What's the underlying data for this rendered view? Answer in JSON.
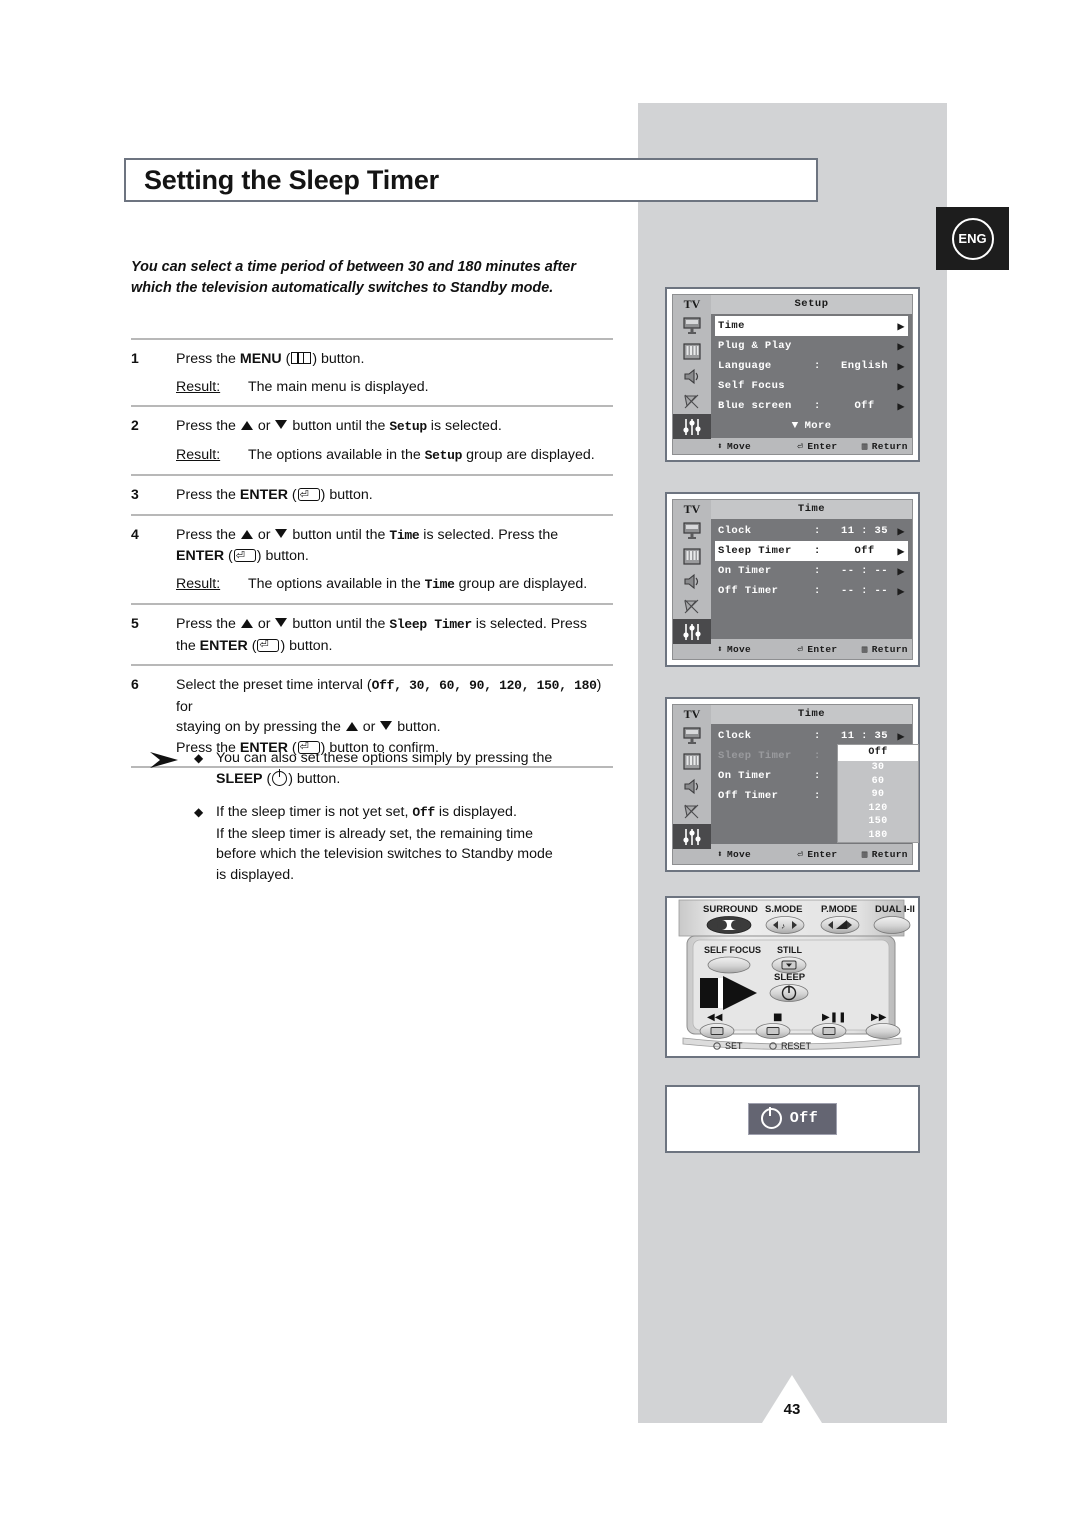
{
  "page": {
    "title": "Setting the Sleep Timer",
    "language_badge": "ENG",
    "page_number": "43",
    "intro_line1": "You can select a time period of between 30 and 180 minutes after",
    "intro_line2": "which the television automatically switches to Standby mode."
  },
  "steps": [
    {
      "num": "1",
      "text_a": "Press the ",
      "kb": "MENU",
      "icon": "menu-icon",
      "text_b": " button.",
      "result_label": "Result:",
      "result_text": "The main menu is displayed."
    },
    {
      "num": "2",
      "text_a": "Press the ",
      "text_b": " button until the ",
      "mono": "Setup",
      "text_c": " is selected.",
      "result_label": "Result:",
      "result_pre": "The options available in the ",
      "result_mono": "Setup",
      "result_post": " group are displayed."
    },
    {
      "num": "3",
      "text_a": "Press the ",
      "kb": "ENTER",
      "icon": "enter-icon",
      "text_b": " button."
    },
    {
      "num": "4",
      "text_a": "Press the ",
      "text_b": " button until the ",
      "mono": "Time",
      "text_c": " is selected. Press the",
      "kb2": "ENTER",
      "text_d": " button.",
      "result_label": "Result:",
      "result_pre": "The options available in the ",
      "result_mono": "Time",
      "result_post": " group are displayed."
    },
    {
      "num": "5",
      "text_a": "Press the ",
      "text_b": " button until the ",
      "mono": "Sleep Timer",
      "text_c": " is selected. Press",
      "text_d": "the ",
      "kb2": "ENTER",
      "text_e": " button."
    },
    {
      "num": "6",
      "text_a": "Select the preset time interval (",
      "options": "Off, 30, 60, 90, 120, 150, 180",
      "text_b": ") for",
      "text_c": "staying on by pressing the ",
      "text_d": " button.",
      "text_e": "Press the ",
      "kb": "ENTER",
      "text_f": " button to confirm."
    }
  ],
  "notes": [
    {
      "line1_a": "You can also set these options simply by pressing the",
      "line2_kb": "SLEEP",
      "line2_b": " button."
    },
    {
      "line1_a": "If the sleep timer is not yet set, ",
      "line1_mono": "Off",
      "line1_b": " is displayed.",
      "line2": "If the sleep timer is already set, the remaining time",
      "line3": "before which the television switches to Standby mode",
      "line4": "is displayed."
    }
  ],
  "osd": {
    "side_label": "TV",
    "footer": {
      "move": "Move",
      "enter": "Enter",
      "return": "Return"
    },
    "setup_menu": {
      "title": "Setup",
      "rows": [
        {
          "label": "Time",
          "colon": "",
          "value": "",
          "selected": true
        },
        {
          "label": "Plug & Play",
          "colon": "",
          "value": "",
          "selected": false
        },
        {
          "label": "Language",
          "colon": ":",
          "value": "English",
          "selected": false
        },
        {
          "label": "Self Focus",
          "colon": "",
          "value": "",
          "selected": false
        },
        {
          "label": "Blue screen",
          "colon": ":",
          "value": "Off",
          "selected": false
        }
      ],
      "more": "More"
    },
    "time_menu": {
      "title": "Time",
      "rows": [
        {
          "label": "Clock",
          "colon": ":",
          "value": "11 : 35",
          "selected": false
        },
        {
          "label": "Sleep Timer",
          "colon": ":",
          "value": "Off",
          "selected": true
        },
        {
          "label": "On Timer",
          "colon": ":",
          "value": "-- : --",
          "selected": false
        },
        {
          "label": "Off Timer",
          "colon": ":",
          "value": "-- : --",
          "selected": false
        }
      ]
    },
    "time_menu_dropdown": {
      "title": "Time",
      "rows": [
        {
          "label": "Clock",
          "colon": ":",
          "value": "11 : 35",
          "selected": false,
          "dim": false
        },
        {
          "label": "Sleep Timer",
          "colon": ":",
          "value": "",
          "selected": false,
          "dim": true
        },
        {
          "label": "On Timer",
          "colon": ":",
          "value": "",
          "selected": false,
          "dim": false
        },
        {
          "label": "Off Timer",
          "colon": ":",
          "value": "",
          "selected": false,
          "dim": false
        }
      ],
      "options": [
        "Off",
        "30",
        "60",
        "90",
        "120",
        "150",
        "180"
      ],
      "selected_option": "Off"
    }
  },
  "remote": {
    "row1": [
      "SURROUND",
      "S.MODE",
      "P.MODE",
      "DUAL I-II"
    ],
    "row2": [
      "SELF FOCUS",
      "STILL"
    ],
    "sleep_label": "SLEEP",
    "set_label": "SET",
    "reset_label": "RESET"
  },
  "off_display": {
    "text": "Off",
    "icon": "power-timer-icon"
  },
  "colors": {
    "grey_band": "#d2d3d5",
    "box_border": "#6d7480",
    "osd_rows_bg": "#76777a",
    "osd_side_bg": "#b9babc",
    "badge_bg": "#1d1d1d",
    "off_chip_bg": "#646572"
  }
}
